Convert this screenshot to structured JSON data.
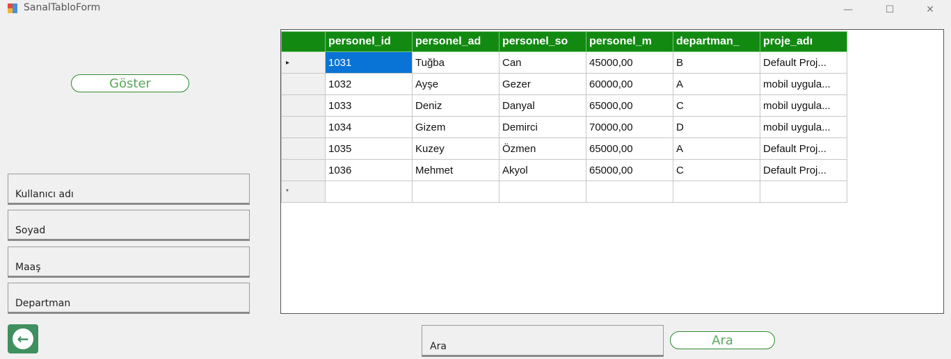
{
  "window": {
    "title": "SanalTabloForm",
    "min_glyph": "—",
    "max_glyph": "☐",
    "close_glyph": "✕"
  },
  "buttons": {
    "goster": "Göster",
    "ara": "Ara",
    "back_glyph": "←"
  },
  "fields": {
    "kullanici": "Kullanıcı adı",
    "soyad": "Soyad",
    "maas": "Maaş",
    "departman": "Departman",
    "ara": "Ara"
  },
  "grid": {
    "columns": [
      "personel_id",
      "personel_ad",
      "personel_so",
      "personel_m",
      "departman_",
      "proje_adı"
    ],
    "rows": [
      [
        "1031",
        "Tuğba",
        "Can",
        "45000,00",
        "B",
        "Default Proj..."
      ],
      [
        "1032",
        "Ayşe",
        "Gezer",
        "60000,00",
        "A",
        "mobil uygula..."
      ],
      [
        "1033",
        "Deniz",
        "Danyal",
        "65000,00",
        "C",
        "mobil uygula..."
      ],
      [
        "1034",
        "Gizem",
        "Demirci",
        "70000,00",
        "D",
        "mobil uygula..."
      ],
      [
        "1035",
        "Kuzey",
        "Özmen",
        "65000,00",
        "A",
        "Default Proj..."
      ],
      [
        "1036",
        "Mehmet",
        "Akyol",
        "65000,00",
        "C",
        "Default Proj..."
      ]
    ],
    "current_row_glyph": "▸",
    "new_row_glyph": "*"
  },
  "colors": {
    "header": "#128a12",
    "selected": "#0a74d6",
    "accent": "#3f8f5f"
  }
}
